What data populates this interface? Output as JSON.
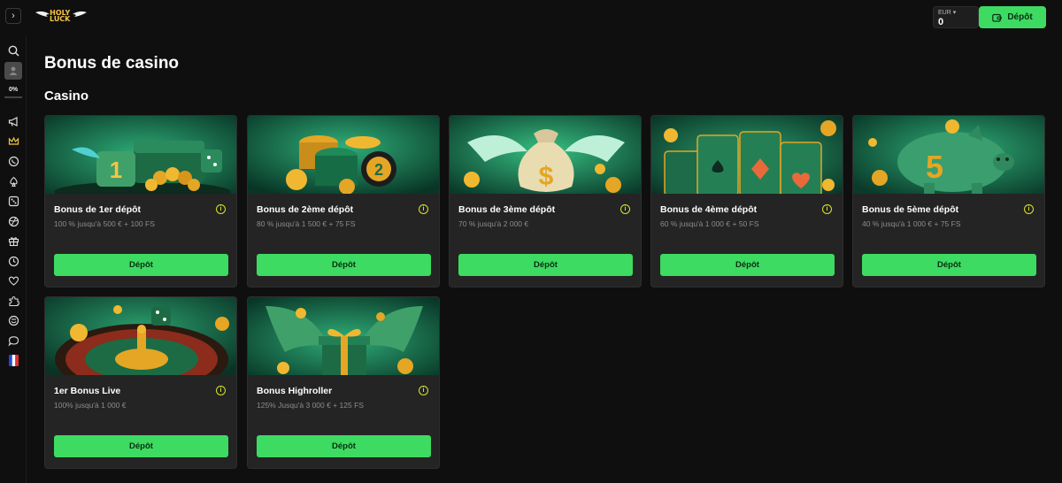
{
  "header": {
    "logo_text_line1": "HOLY",
    "logo_text_line2": "LUCK",
    "balance_currency": "EUR ▾",
    "balance_amount": "0",
    "deposit_label": "Dépôt"
  },
  "sidebar": {
    "progress_text": "0%",
    "progress_fraction": 0,
    "icons": [
      "search-icon",
      "megaphone-icon",
      "crown-icon",
      "whatsapp-icon",
      "spade-icon",
      "dice-icon",
      "sports-ball-icon",
      "gift-icon",
      "clock-icon",
      "heart-icon",
      "puzzle-icon",
      "smiley-icon",
      "chat-icon",
      "flag-fr-icon"
    ]
  },
  "page": {
    "title": "Bonus de casino",
    "section": "Casino"
  },
  "cards": [
    {
      "title": "Bonus de 1er dépôt",
      "desc": "100 % jusqu'à 500 € + 100 FS",
      "button": "Dépôt",
      "info": "i"
    },
    {
      "title": "Bonus de 2ème dépôt",
      "desc": "80 % jusqu'à 1 500 € + 75 FS",
      "button": "Dépôt",
      "info": "i"
    },
    {
      "title": "Bonus de 3ème dépôt",
      "desc": "70 % jusqu'à 2 000 €",
      "button": "Dépôt",
      "info": "i"
    },
    {
      "title": "Bonus de 4ème dépôt",
      "desc": "60 % jusqu'à 1 000 € + 50 FS",
      "button": "Dépôt",
      "info": "i"
    },
    {
      "title": "Bonus de 5ème dépôt",
      "desc": "40 % jusqu'à 1 000 € + 75 FS",
      "button": "Dépôt",
      "info": "i"
    },
    {
      "title": "1er Bonus Live",
      "desc": "100% jusqu'à 1 000 €",
      "button": "Dépôt",
      "info": "i"
    },
    {
      "title": "Bonus Highroller",
      "desc": "125% Jusqu'à 3 000 € + 125 FS",
      "button": "Dépôt",
      "info": "i"
    }
  ],
  "colors": {
    "accent": "#3ddb61",
    "background": "#0f0f0f",
    "card": "#242424",
    "info": "#d8e62a"
  }
}
